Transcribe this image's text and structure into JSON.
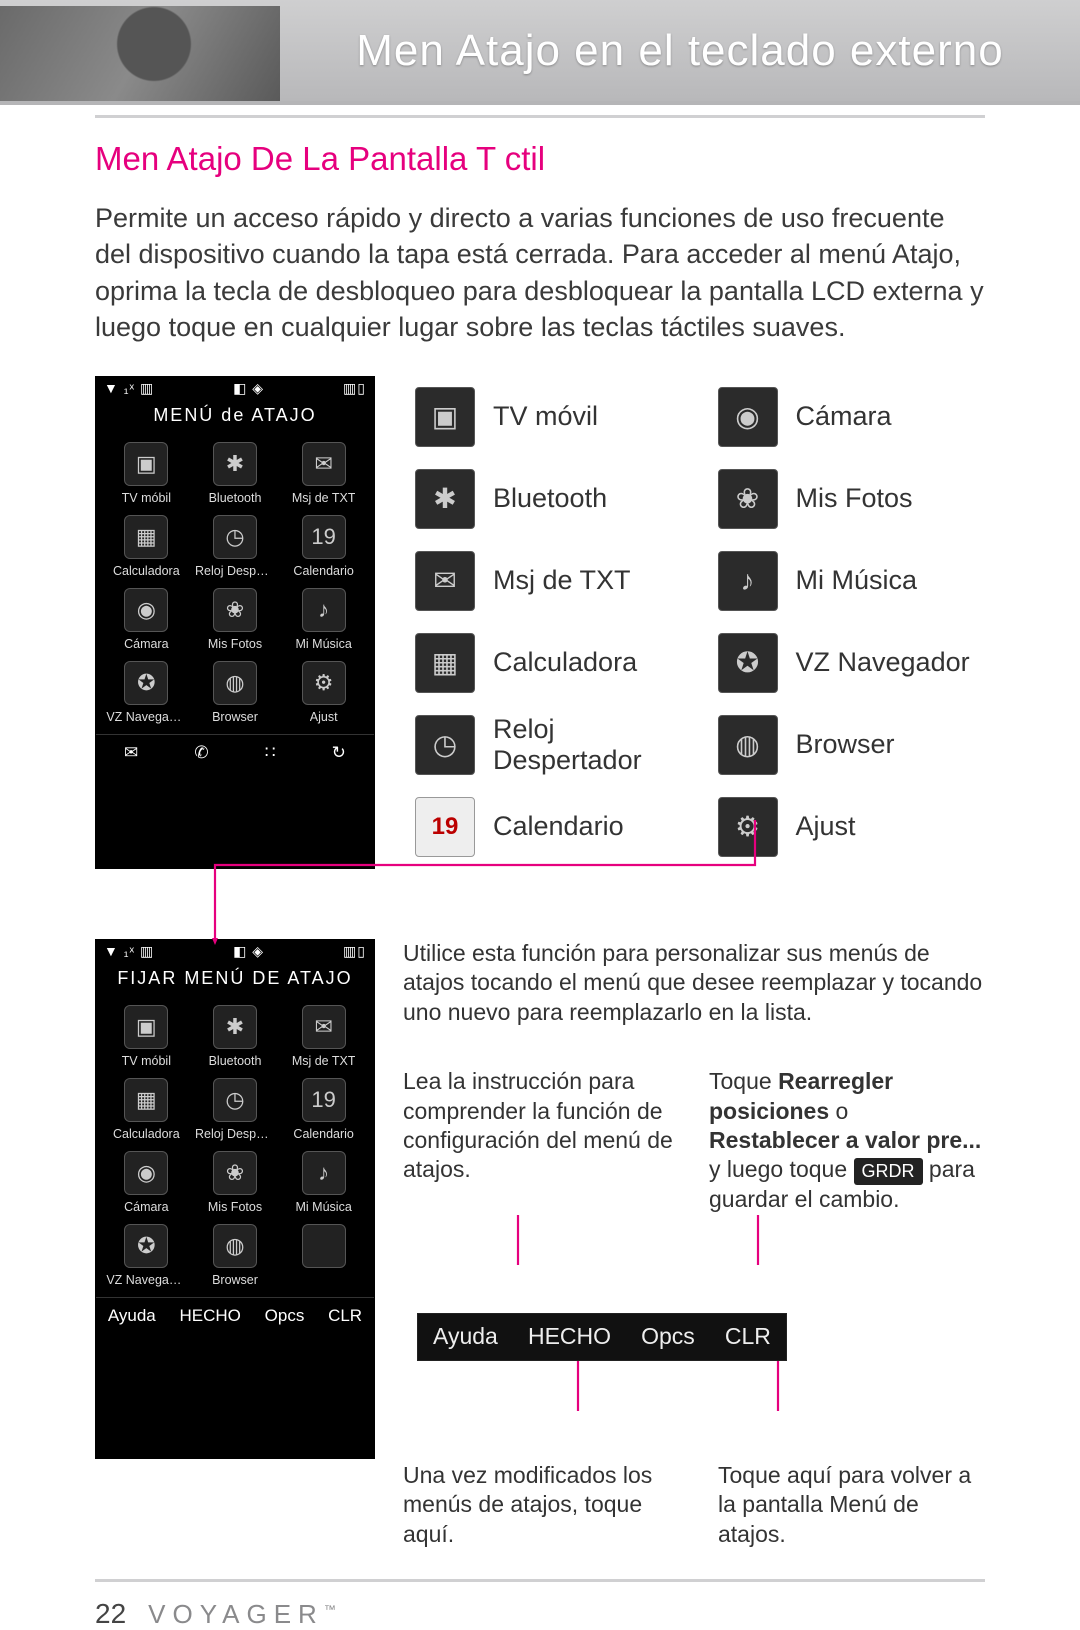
{
  "banner": {
    "title": "Men  Atajo en el teclado externo"
  },
  "section_heading": "Men  Atajo De La Pantalla T ctil",
  "intro": "Permite un acceso rápido y directo a varias funciones de uso frecuente del dispositivo cuando la tapa está cerrada. Para acceder al menú Atajo, oprima la tecla de desbloqueo para desbloquear la pantalla LCD externa y luego toque en cualquier lugar sobre las teclas táctiles suaves.",
  "phone1": {
    "status_left": "▼ ₁ˣ ▥",
    "status_mid": "◧ ◈",
    "status_right": "▥▯",
    "title": "MENÚ de ATAJO",
    "cells": [
      {
        "glyph": "▣",
        "label": "TV móbil"
      },
      {
        "glyph": "✱",
        "label": "Bluetooth"
      },
      {
        "glyph": "✉",
        "label": "Msj de TXT"
      },
      {
        "glyph": "▦",
        "label": "Calculadora"
      },
      {
        "glyph": "◷",
        "label": "Reloj Desper…"
      },
      {
        "glyph": "19",
        "label": "Calendario"
      },
      {
        "glyph": "◉",
        "label": "Cámara"
      },
      {
        "glyph": "❀",
        "label": "Mis Fotos"
      },
      {
        "glyph": "♪",
        "label": "Mi Música"
      },
      {
        "glyph": "✪",
        "label": "VZ Navegador"
      },
      {
        "glyph": "◍",
        "label": "Browser"
      },
      {
        "glyph": "⚙",
        "label": "Ajust"
      }
    ],
    "soft": [
      "✉",
      "✆",
      "∷",
      "↻"
    ]
  },
  "iconlist": {
    "left": [
      {
        "glyph": "▣",
        "label": "TV móvil"
      },
      {
        "glyph": "✱",
        "label": "Bluetooth"
      },
      {
        "glyph": "✉",
        "label": "Msj de TXT"
      },
      {
        "glyph": "▦",
        "label": "Calculadora"
      },
      {
        "glyph": "◷",
        "label": "Reloj Despertador"
      },
      {
        "glyph": "19",
        "label": "Calendario",
        "cal": true
      }
    ],
    "right": [
      {
        "glyph": "◉",
        "label": "Cámara"
      },
      {
        "glyph": "❀",
        "label": "Mis Fotos"
      },
      {
        "glyph": "♪",
        "label": "Mi Música"
      },
      {
        "glyph": "✪",
        "label": "VZ Navegador"
      },
      {
        "glyph": "◍",
        "label": "Browser"
      },
      {
        "glyph": "⚙",
        "label": "Ajust"
      }
    ]
  },
  "phone2": {
    "status_left": "▼ ₁ˣ ▥",
    "status_mid": "◧ ◈",
    "status_right": "▥▯",
    "title": "FIJAR MENÚ DE ATAJO",
    "cells": [
      {
        "glyph": "▣",
        "label": "TV móbil"
      },
      {
        "glyph": "✱",
        "label": "Bluetooth"
      },
      {
        "glyph": "✉",
        "label": "Msj de TXT"
      },
      {
        "glyph": "▦",
        "label": "Calculadora"
      },
      {
        "glyph": "◷",
        "label": "Reloj Despert…"
      },
      {
        "glyph": "19",
        "label": "Calendario"
      },
      {
        "glyph": "◉",
        "label": "Cámara"
      },
      {
        "glyph": "❀",
        "label": "Mis Fotos"
      },
      {
        "glyph": "♪",
        "label": "Mi Música"
      },
      {
        "glyph": "✪",
        "label": "VZ Navegador"
      },
      {
        "glyph": "◍",
        "label": "Browser"
      },
      {
        "glyph": "",
        "label": ""
      }
    ],
    "soft": [
      "Ayuda",
      "HECHO",
      "Opcs",
      "CLR"
    ]
  },
  "right2": {
    "desc": "Utilice esta función para personalizar sus menús de atajos tocando el menú que desee reemplazar y tocando uno nuevo para reemplazarlo en la lista.",
    "col1": "Lea la instrucción para comprender la función de configuración del menú de atajos.",
    "col2_a": "Toque ",
    "col2_b1": "Rearregler posiciones",
    "col2_mid": " o ",
    "col2_b2": "Restablecer a valor pre...",
    "col2_c": " y luego toque ",
    "col2_badge": "GRDR",
    "col2_d": " para guardar el cambio.",
    "softbar": [
      "Ayuda",
      "HECHO",
      "Opcs",
      "CLR"
    ],
    "lower1": "Una vez modificados los menús de atajos, toque aquí.",
    "lower2": "Toque aquí para volver a la pantalla Menú de atajos."
  },
  "footer": {
    "page": "22",
    "brand": "VOYAGER",
    "tm": "™"
  }
}
